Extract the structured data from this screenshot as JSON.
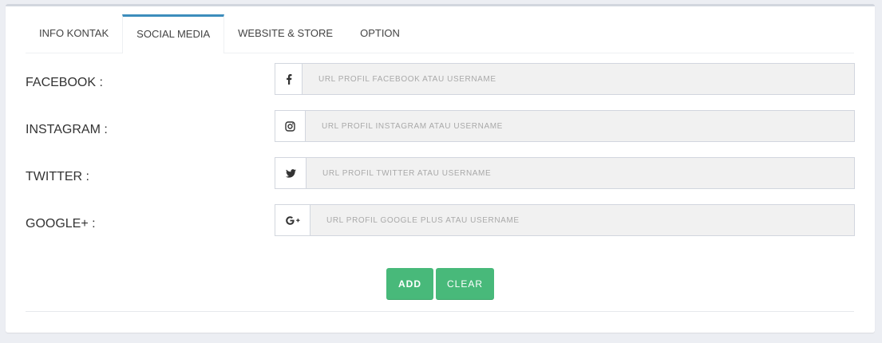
{
  "tabs": [
    {
      "label": "INFO KONTAK",
      "active": false
    },
    {
      "label": "SOCIAL MEDIA",
      "active": true
    },
    {
      "label": "WEBSITE & STORE",
      "active": false
    },
    {
      "label": "OPTION",
      "active": false
    }
  ],
  "fields": {
    "facebook": {
      "label": "FACEBOOK :",
      "icon": "facebook-icon",
      "value": "",
      "placeholder": "URL PROFIL FACEBOOK ATAU USERNAME"
    },
    "instagram": {
      "label": "INSTAGRAM :",
      "icon": "instagram-icon",
      "value": "",
      "placeholder": "URL PROFIL INSTAGRAM ATAU USERNAME"
    },
    "twitter": {
      "label": "TWITTER :",
      "icon": "twitter-icon",
      "value": "",
      "placeholder": "URL PROFIL TWITTER ATAU USERNAME"
    },
    "google_plus": {
      "label": "GOOGLE+ :",
      "icon": "google-plus-icon",
      "value": "",
      "placeholder": "URL PROFIL GOOGLE PLUS ATAU USERNAME"
    }
  },
  "buttons": {
    "add_label": "ADD",
    "clear_label": "CLEAR"
  },
  "colors": {
    "accent": "#3c8dbc",
    "button": "#48b97a",
    "background": "#eceef3",
    "input_fill": "#f1f1f1"
  }
}
